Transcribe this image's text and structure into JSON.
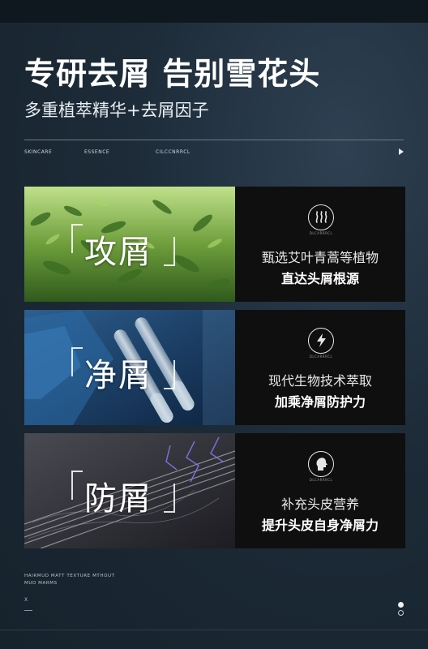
{
  "header": {
    "title": "专研去屑 告别雪花头",
    "subtitle": "多重植萃精华+去屑因子",
    "tags": [
      "SKINCARE",
      "ESSENCE",
      "CILCCNRRCL"
    ]
  },
  "panels": [
    {
      "word": "攻屑",
      "icon_caption": "DLCARRRCL",
      "line1": "甄选艾叶青蒿等植物",
      "line2": "直达头屑根源"
    },
    {
      "word": "净屑",
      "icon_caption": "DLCARRRCL",
      "line1": "现代生物技术萃取",
      "line2": "加乘净屑防护力"
    },
    {
      "word": "防屑",
      "icon_caption": "DLCARRRCL",
      "line1": "补充头皮营养",
      "line2": "提升头皮自身净屑力"
    }
  ],
  "footer": {
    "text": "HAIRMUD MATT TEXTURE MTHOUT MUD MARMS",
    "mark": "X"
  },
  "colors": {
    "background": "#1a2632",
    "panel": "#0f0f10",
    "accent": "#ffffff"
  }
}
